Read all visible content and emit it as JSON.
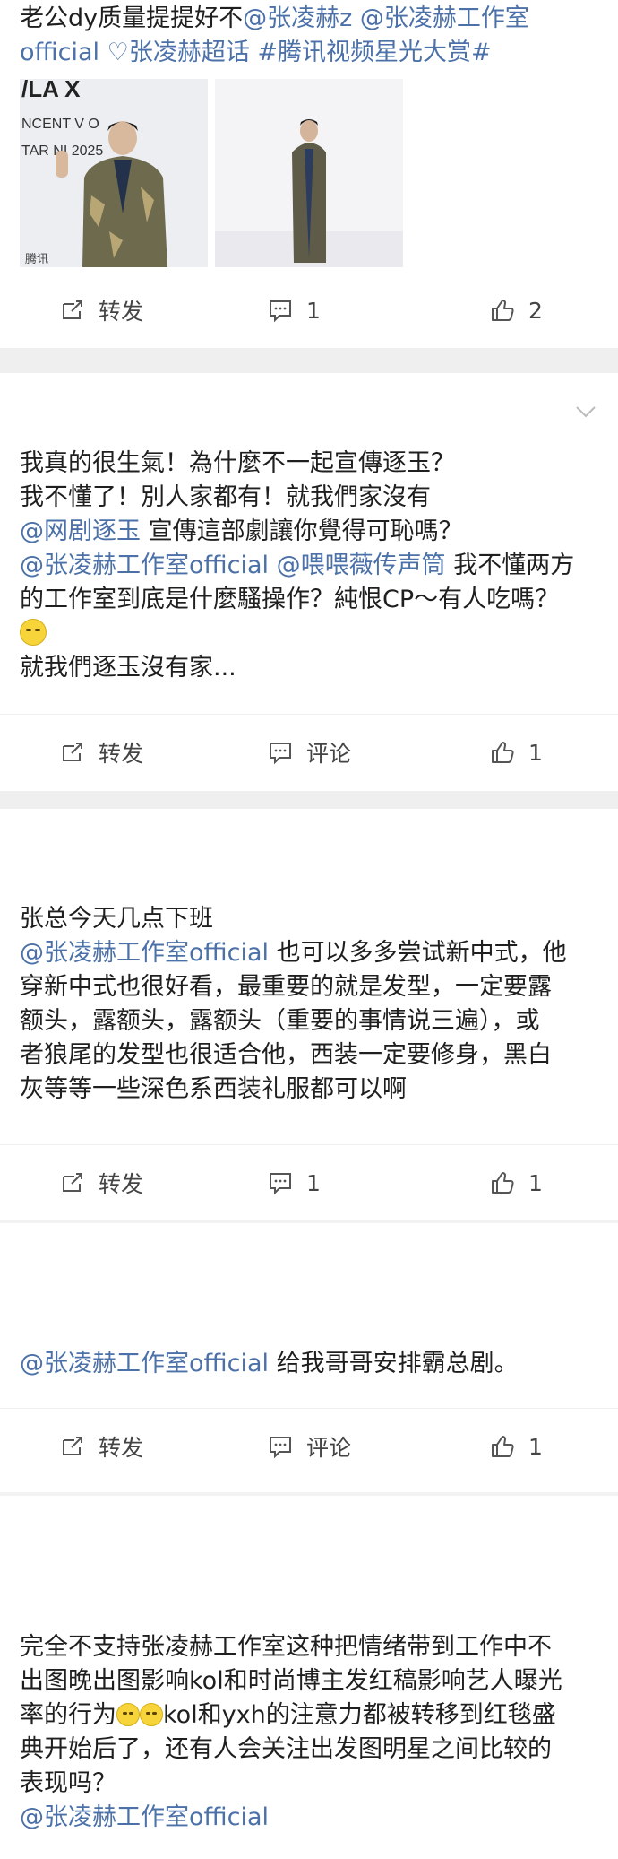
{
  "posts": [
    {
      "lines": [
        [
          {
            "t": "老公dy质量提提好不"
          },
          {
            "t": "@张凌赫z",
            "m": 1
          },
          {
            "t": " "
          },
          {
            "t": "@张凌赫工作室",
            "m": 1
          }
        ],
        [
          {
            "t": "official",
            "m": 1
          },
          {
            "t": " "
          },
          {
            "t": "♡张凌赫超话",
            "m": 1
          },
          {
            "t": " "
          },
          {
            "t": "#腾讯视频星光大赏#",
            "m": 1
          }
        ]
      ],
      "image_text": [
        "/LA X",
        "NCENT V   O",
        "TAR NI    2025",
        "腾讯"
      ],
      "actions": {
        "repost": "转发",
        "comment": "1",
        "like": "2"
      }
    },
    {
      "lines": [
        [
          {
            "t": "我真的很生氣！為什麼不一起宣傳逐玉？"
          }
        ],
        [
          {
            "t": "我不懂了！別人家都有！就我們家沒有"
          }
        ],
        [
          {
            "t": "@网剧逐玉",
            "m": 1
          },
          {
            "t": " 宣傳這部劇讓你覺得可恥嗎？"
          }
        ],
        [
          {
            "t": "@张凌赫工作室official",
            "m": 1
          },
          {
            "t": " "
          },
          {
            "t": "@喂喂薇传声筒",
            "m": 1
          },
          {
            "t": " 我不懂两方"
          }
        ],
        [
          {
            "t": "的工作室到底是什麼騷操作？純恨CP～有人吃嗎？"
          }
        ],
        [
          {
            "t": "__EMOJI__"
          }
        ],
        [
          {
            "t": "就我們逐玉沒有家..."
          }
        ]
      ],
      "actions": {
        "repost": "转发",
        "comment": "评论",
        "like": "1"
      }
    },
    {
      "lines": [
        [
          {
            "t": "张总今天几点下班"
          }
        ],
        [
          {
            "t": " "
          }
        ],
        [
          {
            "t": "@张凌赫工作室official",
            "m": 1
          },
          {
            "t": " 也可以多多尝试新中式，他"
          }
        ],
        [
          {
            "t": "穿新中式也很好看，最重要的就是发型，一定要露"
          }
        ],
        [
          {
            "t": "额头，露额头，露额头（重要的事情说三遍），或"
          }
        ],
        [
          {
            "t": "者狼尾的发型也很适合他，西装一定要修身，黑白"
          }
        ],
        [
          {
            "t": "灰等等一些深色系西装礼服都可以啊"
          }
        ]
      ],
      "actions": {
        "repost": "转发",
        "comment": "1",
        "like": "1"
      }
    },
    {
      "lines": [
        [
          {
            "t": "@张凌赫工作室official",
            "m": 1
          },
          {
            "t": " 给我哥哥安排霸总剧。"
          }
        ]
      ],
      "actions": {
        "repost": "转发",
        "comment": "评论",
        "like": "1"
      }
    },
    {
      "lines": [
        [
          {
            "t": "完全不支持张凌赫工作室这种把情绪带到工作中不"
          }
        ],
        [
          {
            "t": "出图晚出图影响kol和时尚博主发红稿影响艺人曝光"
          }
        ],
        [
          {
            "t": "率的行为"
          },
          {
            "t": "__EMOJI2__"
          },
          {
            "t": "kol和yxh的注意力都被转移到红毯盛"
          }
        ],
        [
          {
            "t": "典开始后了，还有人会关注出发图明星之间比较的"
          }
        ],
        [
          {
            "t": "表现吗？"
          }
        ],
        [
          {
            "t": "@张凌赫工作室official",
            "m": 1
          }
        ]
      ]
    }
  ],
  "icons": {
    "repost": "repost-icon",
    "comment": "comment-icon",
    "like": "like-icon",
    "collapse": "chevron-down-icon",
    "emoji": "rolling-eyes-emoji"
  },
  "colors": {
    "mention": "#4b71a8",
    "text": "#1f1f1f",
    "divider": "#efefef"
  }
}
